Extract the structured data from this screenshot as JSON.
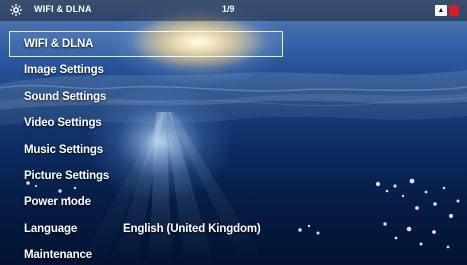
{
  "header": {
    "icon": "gear-icon",
    "title": "WIFI & DLNA",
    "page_indicator": "1/9",
    "status_icon": "warning-badge-icon"
  },
  "menu": {
    "items": [
      {
        "label": "WIFI & DLNA",
        "selected": true
      },
      {
        "label": "Image Settings"
      },
      {
        "label": "Sound Settings"
      },
      {
        "label": "Video Settings"
      },
      {
        "label": "Music Settings"
      },
      {
        "label": "Picture Settings"
      },
      {
        "label": "Power mode"
      },
      {
        "label": "Language",
        "value": "English (United Kingdom)"
      },
      {
        "label": "Maintenance"
      }
    ]
  },
  "colors": {
    "status_red": "#d61d2a",
    "selection_border": "#ffffff"
  }
}
